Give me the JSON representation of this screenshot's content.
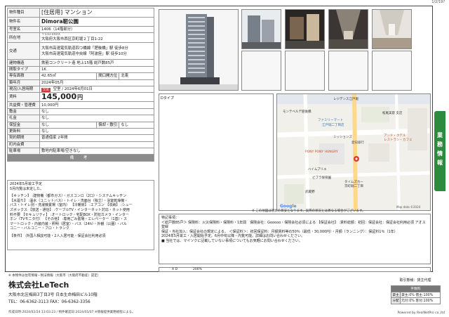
{
  "page_number": "1/2/19?",
  "property": {
    "type_label": "物件種目",
    "type_value": "[住居用] マンション",
    "name_label": "物件名",
    "name_value": "Dimora靭公園",
    "room_label": "号室名",
    "room_value": "1406（14階部分）",
    "address_label": "所在地",
    "address_postal": "〒550-0XXX",
    "address_value": "大阪府大阪市西区京町堀２丁目1-22",
    "traffic_label": "交通",
    "traffic_lines": [
      "大阪市高速電気軌道四つ橋線「肥後橋」駅 徒歩8分",
      "大阪市高速電気軌道中央線「阿波座」駅 徒歩10分",
      ""
    ],
    "structure_label": "建物構造",
    "structure_value": "鉄筋コンクリート造 地上15階 総戸数85戸",
    "layout_label": "間取タイプ",
    "layout_value": "1K",
    "area_label": "専有面積",
    "area_value": "42.65㎡",
    "orientation_label": "間口開方位",
    "orientation_value": "北東",
    "built_label": "築年月",
    "built_value": "2024年05月",
    "status_label": "現況/入居時期",
    "status_badge": "空室",
    "status_value": "空室 / 2024年6月01日",
    "rent_label": "賃料",
    "rent_value": "145,000",
    "rent_unit": "円",
    "fee_label": "共益費・管理費",
    "fee_value": "10,000円",
    "deposit_label": "敷金",
    "deposit_value": "なし",
    "key_money_label": "礼金",
    "key_money_value": "なし",
    "guarantee_label": "保証金",
    "guarantee_value": "なし",
    "amortization_label": "償却・敷引",
    "amortization_value": "なし",
    "renewal_label": "更新料",
    "renewal_value": "なし",
    "contract_label": "契約期間",
    "contract_value": "普通借家 2年間",
    "other_label": "町内会費",
    "other_value": "",
    "parking_label": "駐車場",
    "parking_value": "敷地内駐車場/空きなし",
    "remarks_header": "備 考"
  },
  "remarks": {
    "lines": [
      "2024年5月竣工予定",
      "5月内覧は未定した。"
    ],
    "equipment_lines": [
      "【キッチン】 :建物備（都市ガス）・ガスコンロ（2口）・システムキッチン",
      "【水廻り】 :温水（ユニットバス）・トイレ・洗面台（独立）・浴室乾燥機・",
      "バス・トイレ別・洗濯機置場（室内） 【冷暖房】 :エアコン 【収納】 :シュー",
      "ズボックス 【放送・通信】 :ケーブルTV・インターネット対応・ネット使用",
      "料不要 【セキュリティ】 :オートロック・宅配BOX・防犯カメラ・インター",
      "ホン（TVモニタ付） 【その他】 :専用ごみ置場・エレベーター（1基）・ス",
      "マートロック・内装内装・照明（居室）・バス（24h）・外観（公園）・バル",
      "コニー・バルコニー・フロ・トランク"
    ],
    "condition_line": "【条件】 :外国人相談可能・2人入居可能・保証会社利用必須"
  },
  "floorplan_label": "Dタイプ",
  "map": {
    "labels": [
      "レジデンス江戸堀",
      "モンテベルデ肥後橋",
      "ファミリーマート",
      "江戸堀二丁目店",
      "ミッションズ",
      "愛知銀行",
      "PONY PONY HUNGRY",
      "松尾美容 支店",
      "アンド・ホテル",
      "レストラン・カフェ",
      "ハイムブリエ",
      "ビブラ保育園",
      "タイムズカー",
      "京町堀二丁目",
      "武蔵野",
      "Google",
      "Map data ©2024"
    ],
    "note": "※ この地図は現状の目安となります。実際の状況とは異なる場合がございます。"
  },
  "features": {
    "label": "特記事項：",
    "lines": [
      "＜総戸数85戸＞ 保険料：火災保険料・保険料・1年間　保険会社：Gooooo・保険会社必須による 【保証会社】 :賃料総額：初回：保証会社：保証会社利用必須 アオス登録",
      "保証・当社加入：保証会社の規定による。 ＜保証料＞：初回保証料：月額賃料等の50％（最低・30,000円）・月額（ランニング）：保証料1％（1年）",
      "2024年5月竣工・入居開始予定。6月中旬以降・内覧可能。詳細はお問い合わせください。",
      "■ 当社では、マイソクに記載していない事項についてもお気軽にお問い合わせください。"
    ]
  },
  "scale_labels": [
    "A D",
    "200%"
  ],
  "side_tab": "業務情報",
  "footer": {
    "notice": "※ 本物件は住宅情報・税法情報（大阪市（大阪府不動産）認定）",
    "company": "株式会社LeTech",
    "address": "大阪市北区梅田3丁目3号 日本生命梅田ビル10階",
    "tel": "TEL：06-6362-3113 FAX：06-6362-3356",
    "meta": "作成日時:2024/02/24 13:03:23 / 物件確認日:2024/05/07 ※情報提供業務規程による。",
    "powered": "Powered by RealNetPro co.,ltd",
    "deal_label": "取引態様：貸主代理",
    "deal_header": "手数料",
    "deal_rows": [
      {
        "k": "貸主",
        "v": "貸主:0% 借主:100%"
      },
      {
        "k": "分配",
        "v": "元付:0% 客付:100%"
      }
    ]
  },
  "colors": {
    "accent_green": "#2e8b3e",
    "badge_red": "#d43a3a",
    "header_gray": "#8c8c8c"
  }
}
